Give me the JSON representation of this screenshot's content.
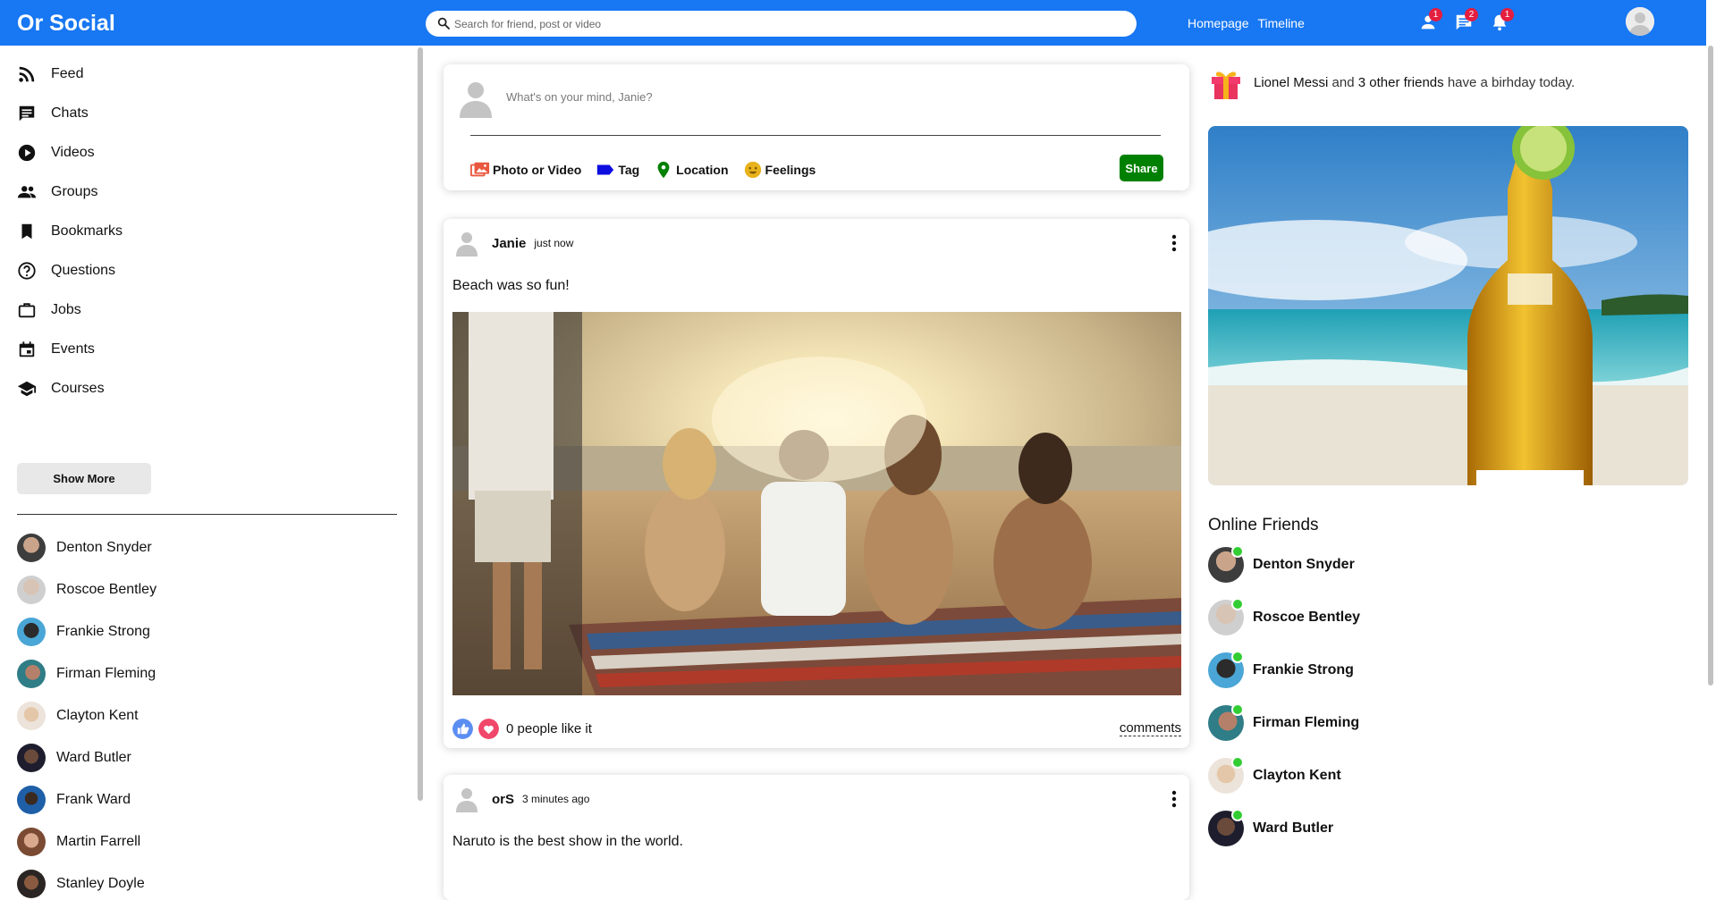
{
  "app": {
    "title": "Or Social"
  },
  "search": {
    "placeholder": "Search for friend, post or video"
  },
  "nav": {
    "links": [
      "Homepage",
      "Timeline"
    ]
  },
  "notifications": {
    "friends": "1",
    "messages": "2",
    "alerts": "1"
  },
  "sidebar": {
    "menu": [
      {
        "label": "Feed",
        "icon": "rss-icon"
      },
      {
        "label": "Chats",
        "icon": "chat-icon"
      },
      {
        "label": "Videos",
        "icon": "play-circle-icon"
      },
      {
        "label": "Groups",
        "icon": "group-icon"
      },
      {
        "label": "Bookmarks",
        "icon": "bookmark-icon"
      },
      {
        "label": "Questions",
        "icon": "question-icon"
      },
      {
        "label": "Jobs",
        "icon": "briefcase-icon"
      },
      {
        "label": "Events",
        "icon": "calendar-icon"
      },
      {
        "label": "Courses",
        "icon": "school-icon"
      }
    ],
    "show_more": "Show More",
    "friends": [
      "Denton Snyder",
      "Roscoe Bentley",
      "Frankie Strong",
      "Firman Fleming",
      "Clayton Kent",
      "Ward Butler",
      "Frank Ward",
      "Martin Farrell",
      "Stanley Doyle"
    ]
  },
  "share": {
    "placeholder": "What's on your mind, Janie?",
    "options": [
      "Photo or Video",
      "Tag",
      "Location",
      "Feelings"
    ],
    "button": "Share"
  },
  "posts": [
    {
      "author": "Janie",
      "time": "just now",
      "text": "Beach was so fun!",
      "likes": "0 people like it",
      "comments": "comments"
    },
    {
      "author": "orS",
      "time": "3 minutes ago",
      "text": "Naruto is the best show in the world."
    }
  ],
  "birthday": {
    "name": "Lionel Messi",
    "connector": "and",
    "others": "3 other friends",
    "suffix": "have a birhday today."
  },
  "online": {
    "title": "Online Friends",
    "friends": [
      "Denton Snyder",
      "Roscoe Bentley",
      "Frankie Strong",
      "Firman Fleming",
      "Clayton Kent",
      "Ward Butler"
    ]
  },
  "colors": {
    "brand": "#1877f2",
    "share": "#008000",
    "online": "#32cd32",
    "badge": "#e41e3f"
  }
}
